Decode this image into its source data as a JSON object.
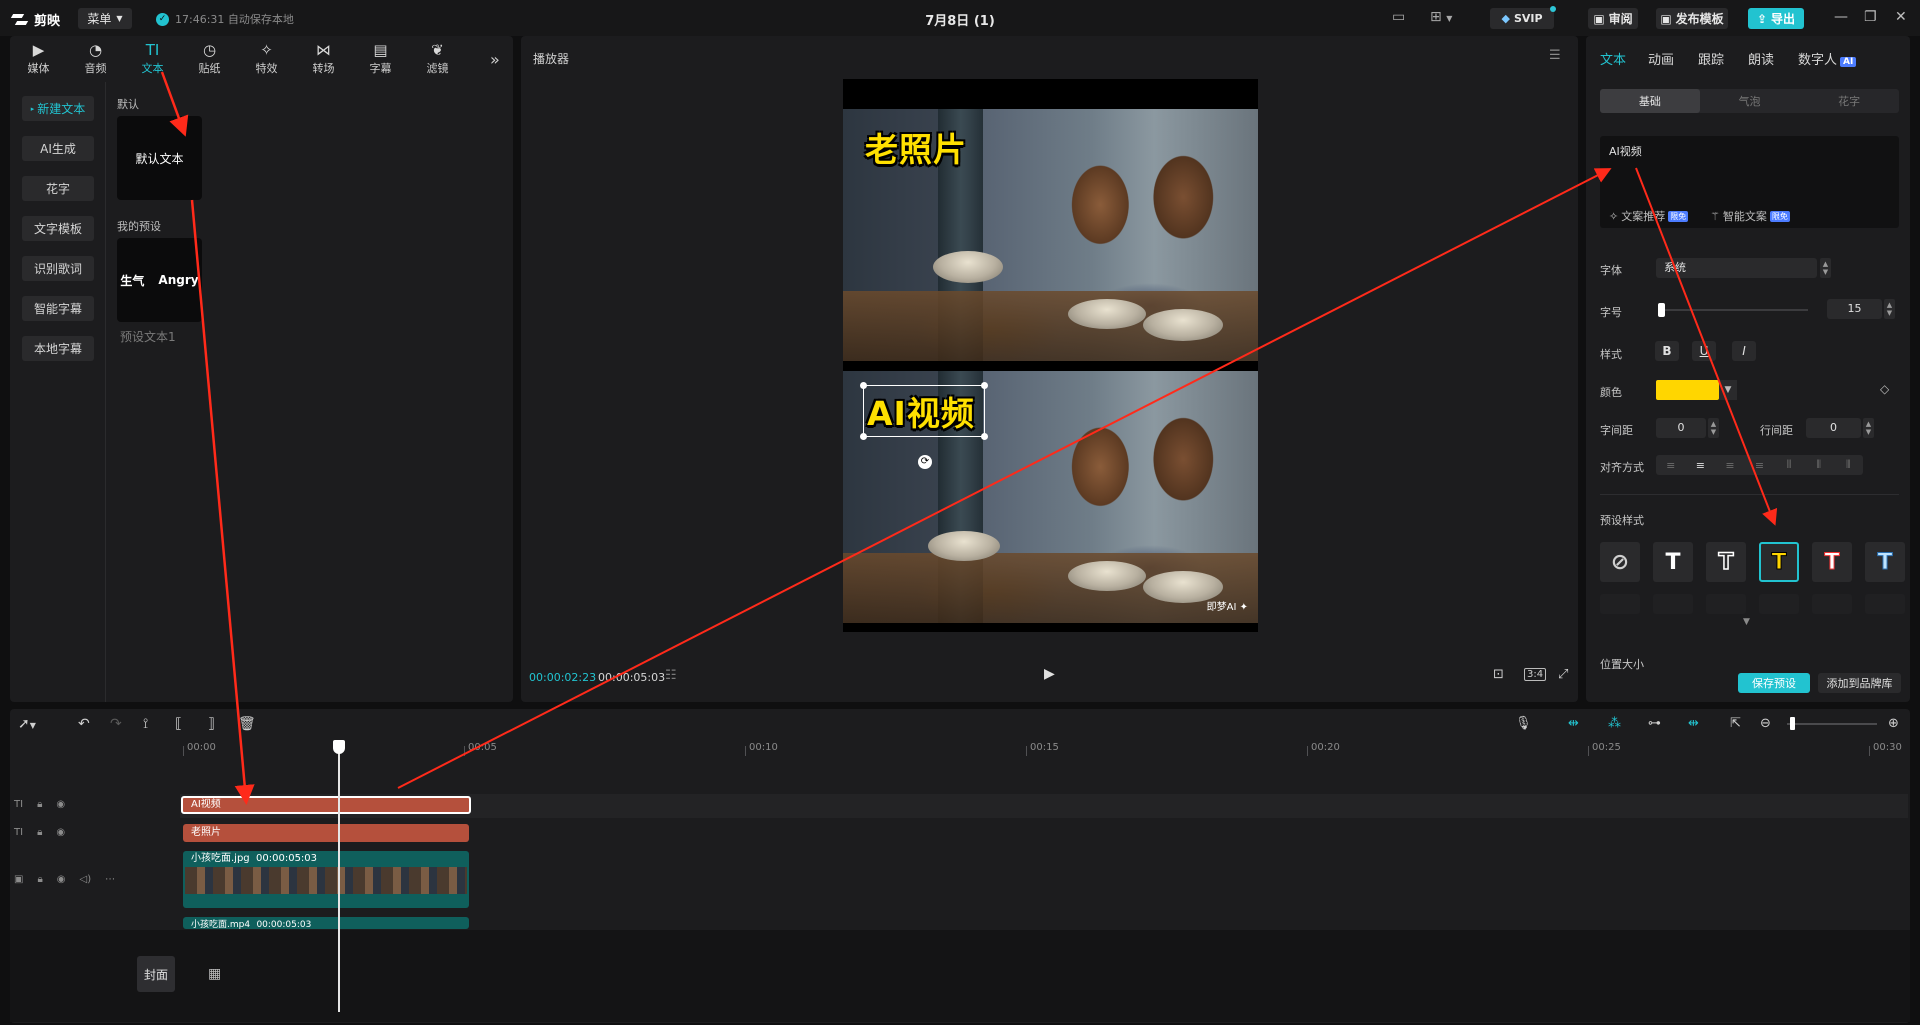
{
  "app": {
    "logo": "剪映",
    "menu": "菜单",
    "save_status": "17:46:31 自动保存本地",
    "project_title": "7月8日 (1)",
    "svip": "SVIP",
    "review": "审阅",
    "publish": "发布模板",
    "export": "导出"
  },
  "tool_tabs": [
    {
      "label": "媒体",
      "icon": "media-icon"
    },
    {
      "label": "音频",
      "icon": "audio-icon"
    },
    {
      "label": "文本",
      "icon": "text-icon",
      "active": true
    },
    {
      "label": "贴纸",
      "icon": "sticker-icon"
    },
    {
      "label": "特效",
      "icon": "effects-icon"
    },
    {
      "label": "转场",
      "icon": "transition-icon"
    },
    {
      "label": "字幕",
      "icon": "subtitle-icon"
    },
    {
      "label": "滤镜",
      "icon": "filter-icon"
    }
  ],
  "side_menu": [
    "新建文本",
    "AI生成",
    "花字",
    "文字模板",
    "识别歌词",
    "智能字幕",
    "本地字幕"
  ],
  "text_library": {
    "default_label": "默认",
    "default_card": "默认文本",
    "my_presets_label": "我的预设",
    "preset_card_left": "生气",
    "preset_card_right": "Angry",
    "preset_name": "预设文本1"
  },
  "player": {
    "title": "播放器",
    "text_top": "老照片",
    "text_bottom": "AI视频",
    "watermark": "即梦AI ✦",
    "current_time": "00:00:02:23",
    "total_time": "00:00:05:03",
    "ratio": "3:4"
  },
  "right_panel": {
    "tabs": [
      "文本",
      "动画",
      "跟踪",
      "朗读",
      "数字人"
    ],
    "ai_badge": "AI",
    "subtabs": [
      "基础",
      "气泡",
      "花字"
    ],
    "text_value": "AI视频",
    "copy_recommend": "文案推荐",
    "smart_copy": "智能文案",
    "limit_badge": "限免",
    "font_label": "字体",
    "font_value": "系统",
    "size_label": "字号",
    "size_value": "15",
    "style_label": "样式",
    "style_bold": "B",
    "style_underline": "U",
    "style_italic": "I",
    "color_label": "颜色",
    "color_value": "#ffd600",
    "letter_spacing_label": "字间距",
    "letter_spacing_value": "0",
    "line_spacing_label": "行间距",
    "line_spacing_value": "0",
    "align_label": "对齐方式",
    "preset_styles_label": "预设样式",
    "preset_T": "T",
    "position_label": "位置大小",
    "save_preset": "保存预设",
    "add_brand": "添加到品牌库"
  },
  "timeline": {
    "ruler": [
      "00:00",
      "00:05",
      "00:10",
      "00:15",
      "00:20",
      "00:25",
      "00:30"
    ],
    "clips": {
      "text1": "AI视频",
      "text2": "老照片",
      "video1_name": "小孩吃面.jpg",
      "video1_dur": "00:00:05:03",
      "video2_name": "小孩吃面.mp4",
      "video2_dur": "00:00:05:03"
    },
    "cover": "封面"
  }
}
